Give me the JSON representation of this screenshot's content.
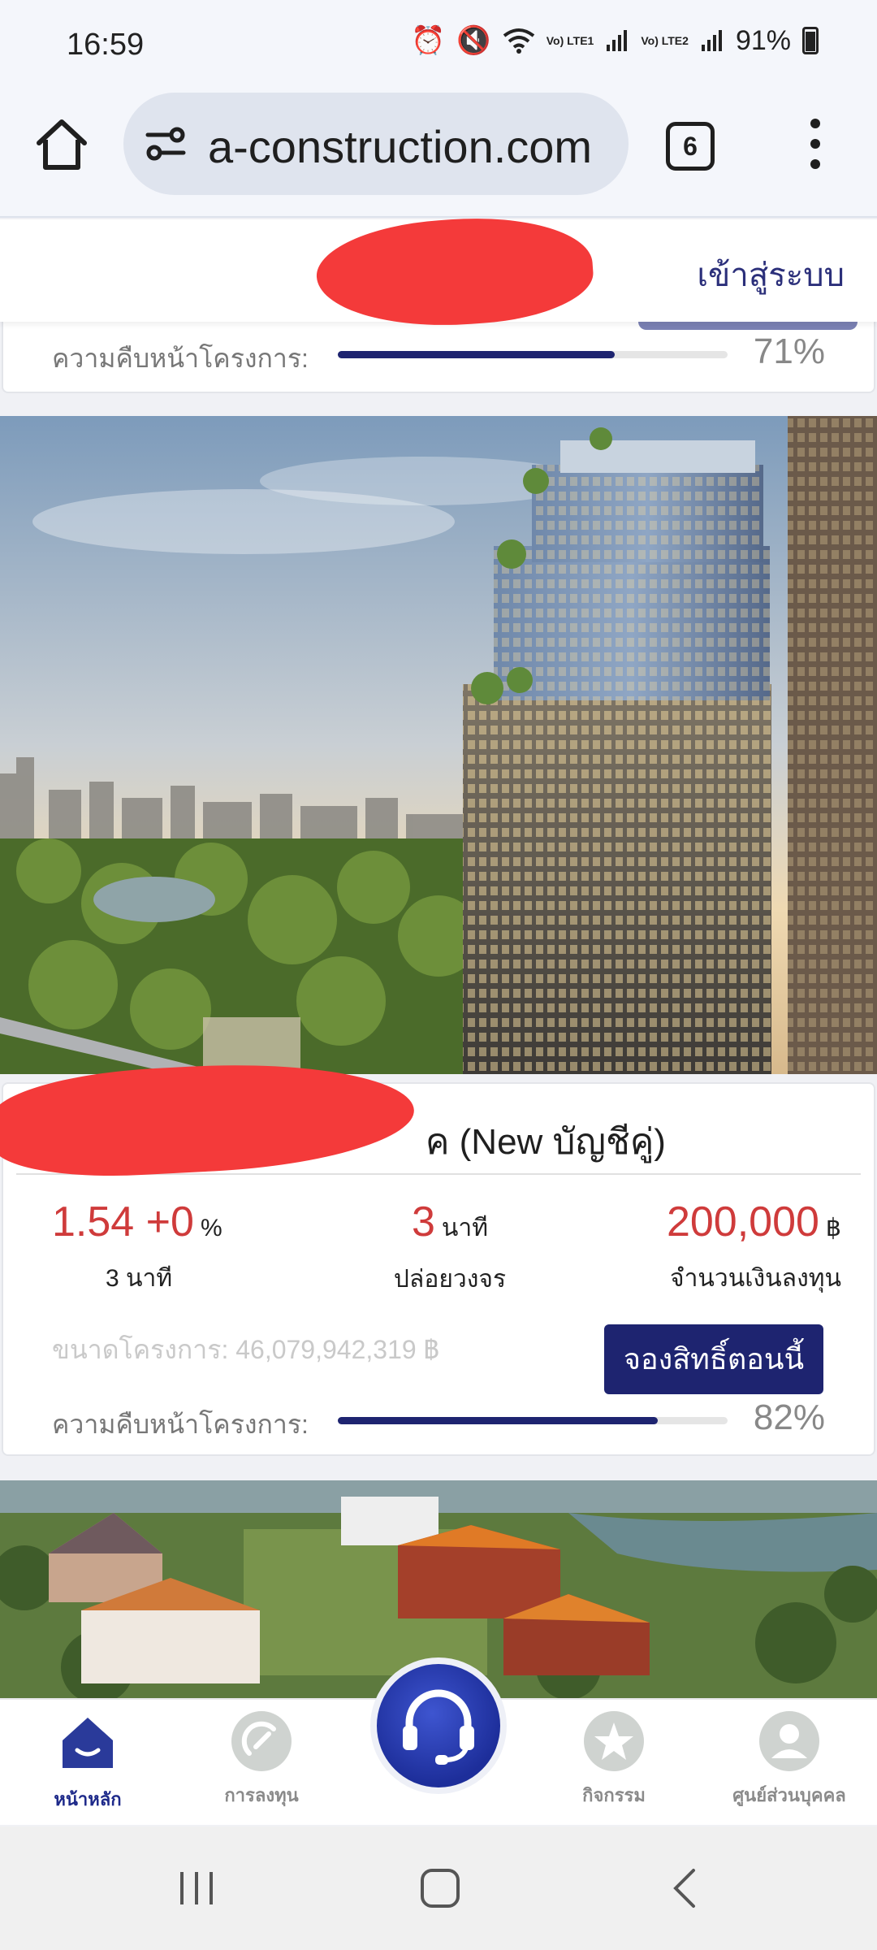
{
  "status_bar": {
    "time": "16:59",
    "net1": "Vo) LTE1",
    "net2": "Vo) LTE2",
    "battery": "91%"
  },
  "browser": {
    "url": "a-construction.com",
    "tab_count": "6"
  },
  "header": {
    "login_label": "เข้าสู่ระบบ"
  },
  "project_1": {
    "progress_label": "ความคืบหน้าโครงการ:",
    "progress_text": "71%",
    "progress_value": 71
  },
  "project_2": {
    "title_visible": "ค (New บัญชีคู่)",
    "rate_value": "1.54 +0",
    "rate_unit": "%",
    "rate_caption": "3 นาที",
    "period_value": "3",
    "period_unit": "นาที",
    "period_caption": "ปล่อยวงจร",
    "amount_value": "200,000",
    "amount_unit": "฿",
    "amount_caption": "จำนวนเงินลงทุน",
    "size_label": "ขนาดโครงการ:",
    "size_value": "46,079,942,319 ฿",
    "book_label": "จองสิทธิ์ตอนนี้",
    "progress_label": "ความคืบหน้าโครงการ:",
    "progress_text": "82%",
    "progress_value": 82
  },
  "bottom_nav": {
    "home": "หน้าหลัก",
    "invest": "การลงทุน",
    "activity": "กิจกรรม",
    "profile": "ศูนย์ส่วนบุคคล",
    "icons": [
      "home-icon",
      "invest-icon",
      "headset-icon",
      "star-icon",
      "user-icon"
    ]
  },
  "colors": {
    "brand_navy": "#1e2470",
    "value_red": "#cf3b3b",
    "redaction": "#f43a3a"
  }
}
